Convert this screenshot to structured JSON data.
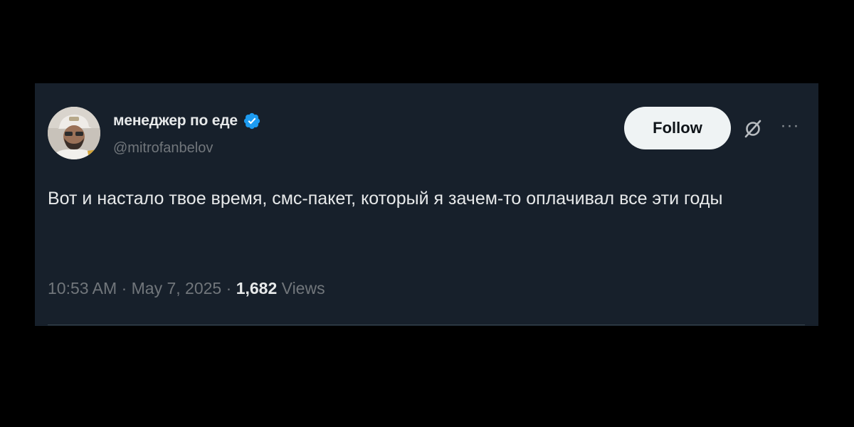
{
  "tweet": {
    "author": {
      "display_name": "менеджер по еде",
      "handle": "@mitrofanbelov",
      "verified": true,
      "verified_color": "#1d9bf0",
      "avatar_icon": "user-avatar"
    },
    "follow_label": "Follow",
    "text": "Вот и настало твое время, смс-пакет, который я зачем-то оплачивал все эти годы",
    "time": "10:53 AM",
    "separator": "·",
    "date": "May 7, 2025",
    "views_count": "1,682",
    "views_label": "Views",
    "icons": {
      "grok": "grok-icon",
      "more": "more-icon"
    }
  },
  "colors": {
    "background": "#000000",
    "card": "#17202b",
    "text_primary": "#e7e9ea",
    "text_secondary": "#71767b",
    "button_bg": "#eff3f4"
  }
}
